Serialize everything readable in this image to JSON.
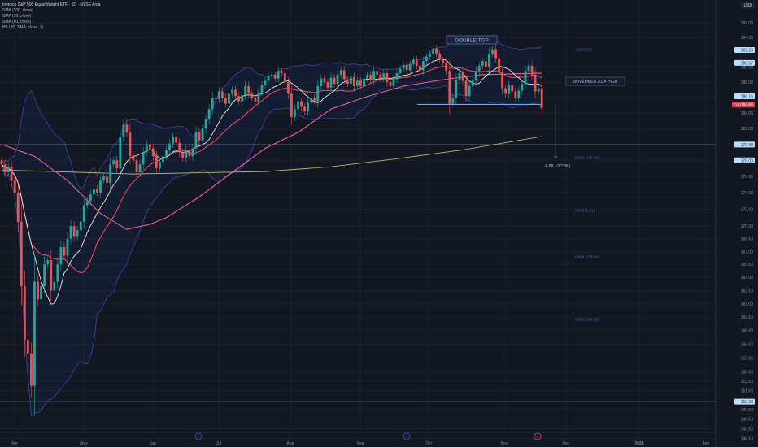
{
  "header": {
    "title": "Invesco S&P 500 Equal Weight ETF · 1D · NYSE Arca",
    "indicators": [
      "SMA (200, close)",
      "SMA (10, close)",
      "SMA (50, close)",
      "BB (20, SMA, close, 2)"
    ],
    "currency": "USD"
  },
  "colors": {
    "background": "#131722",
    "up": "#26a69a",
    "down": "#ef5350",
    "sma10": "#efe7cf",
    "bb_basis": "#f0465a",
    "sma50": "#ec5f99",
    "sma200": "#b8b46a",
    "bb_band": "#3949ab",
    "label_bg": "#bbdefb",
    "annotation": "#5b8fd6"
  },
  "chart_data": {
    "type": "candlestick",
    "symbol": "ESP",
    "scale": "log",
    "ylim": [
      145.5,
      197
    ],
    "grid": true,
    "x_ticks": [
      "Apr",
      "May",
      "Jun",
      "Jul",
      "Aug",
      "Sep",
      "Oct",
      "Nov",
      "Dec",
      "2026",
      "Feb"
    ],
    "y_ticks": [
      "196.00",
      "194.00",
      "190.00",
      "188.00",
      "186.00",
      "184.00",
      "182.00",
      "180.00",
      "178.00",
      "176.00",
      "174.00",
      "172.00",
      "170.00",
      "168.50",
      "167.00",
      "165.50",
      "164.00",
      "162.50",
      "161.00",
      "159.50",
      "158.00",
      "156.50",
      "155.00",
      "153.50",
      "152.50",
      "151.50",
      "149.50",
      "148.50",
      "147.50",
      "146.50"
    ],
    "closes": [
      177.5,
      176.5,
      177.2,
      175.5,
      174.0,
      170.5,
      163.0,
      157.0,
      155.5,
      152.0,
      163.5,
      161.5,
      163.0,
      165.5,
      166.0,
      162.5,
      163.5,
      165.5,
      167.5,
      166.5,
      168.5,
      170.0,
      168.8,
      169.5,
      170.5,
      172.5,
      173.0,
      173.8,
      174.5,
      174.0,
      175.5,
      176.0,
      175.2,
      177.5,
      178.0,
      177.0,
      181.0,
      182.5,
      181.5,
      178.5,
      178.0,
      176.5,
      177.5,
      179.0,
      180.0,
      179.5,
      178.5,
      177.0,
      177.8,
      178.5,
      179.3,
      180.1,
      181.0,
      180.2,
      179.0,
      178.3,
      179.3,
      178.5,
      179.5,
      181.5,
      180.5,
      182.0,
      183.2,
      184.5,
      186.0,
      185.8,
      186.8,
      186.0,
      185.2,
      186.5,
      187.0,
      186.2,
      185.5,
      186.3,
      187.5,
      186.5,
      186.0,
      185.5,
      186.7,
      187.6,
      188.2,
      188.8,
      189.0,
      188.5,
      189.5,
      189.2,
      188.0,
      186.5,
      183.5,
      184.5,
      185.5,
      184.8,
      184.2,
      185.3,
      186.0,
      185.5,
      187.5,
      188.5,
      188.0,
      187.3,
      188.6,
      187.8,
      189.0,
      189.6,
      188.4,
      187.8,
      188.7,
      187.5,
      188.2,
      187.5,
      188.5,
      189.0,
      188.3,
      189.5,
      189.0,
      188.5,
      189.2,
      188.0,
      187.5,
      188.4,
      189.2,
      189.8,
      190.3,
      189.6,
      190.4,
      191.0,
      190.2,
      189.6,
      190.8,
      191.4,
      191.8,
      192.5,
      191.8,
      191.0,
      190.6,
      189.5,
      185.2,
      186.0,
      188.3,
      189.2,
      188.2,
      186.2,
      187.5,
      188.2,
      189.5,
      190.2,
      190.8,
      190.0,
      191.8,
      192.4,
      191.2,
      189.3,
      187.2,
      186.5,
      187.6,
      186.8,
      186.0,
      186.9,
      187.8,
      189.5,
      190.2,
      189.0,
      186.8,
      187.2,
      184.66
    ],
    "sma50": [
      [
        0,
        180.0
      ],
      [
        10,
        178.5
      ],
      [
        20,
        175.5
      ],
      [
        30,
        171.5
      ],
      [
        38,
        169.6
      ],
      [
        45,
        170.2
      ],
      [
        50,
        171.0
      ],
      [
        60,
        173.5
      ],
      [
        70,
        176.5
      ],
      [
        80,
        179.5
      ],
      [
        90,
        181.5
      ],
      [
        100,
        184.5
      ],
      [
        110,
        186.0
      ],
      [
        122,
        187.5
      ],
      [
        135,
        188.4
      ],
      [
        146,
        189.0
      ],
      [
        164,
        189.2
      ]
    ],
    "sma200": [
      [
        0,
        176.8
      ],
      [
        40,
        176.3
      ],
      [
        80,
        176.6
      ],
      [
        100,
        177.2
      ],
      [
        120,
        178.2
      ],
      [
        140,
        179.3
      ],
      [
        164,
        181.0
      ]
    ],
    "price_labels": [
      {
        "text": "192.30",
        "value": 192.3,
        "line": true
      },
      {
        "text": "190.57",
        "value": 190.57,
        "line": true
      },
      {
        "text": "186.16",
        "value": 186.16,
        "line": false
      },
      {
        "text": "185.11",
        "value": 185.11,
        "line": false
      },
      {
        "text": "179.98",
        "value": 179.98,
        "line": true
      },
      {
        "text": "178.00",
        "value": 178.0,
        "line": false
      },
      {
        "text": "150.33",
        "value": 150.33,
        "line": true
      }
    ],
    "last_price": {
      "symbol": "ESP",
      "text": "184.66",
      "value": 184.66
    },
    "annotations": {
      "double_top": "DOUBLE TOP",
      "double_top_level": 192.3,
      "neckline_level": 185.11,
      "november_high": "NOVEMBER 2024 HIGH",
      "measure": "-6.89 (-3.72%)",
      "measure_from": 185.11,
      "measure_to": 178.22
    },
    "fib_levels": [
      {
        "text": "1 (192.30)",
        "value": 192.3
      },
      {
        "text": "0.382 (178.28)",
        "value": 178.28
      },
      {
        "text": "0.5 (171.81)",
        "value": 171.81
      },
      {
        "text": "0.618 (166.34)",
        "value": 166.34
      },
      {
        "text": "0.786 (159.21)",
        "value": 159.21
      }
    ],
    "events": [
      {
        "type": "dividend",
        "label": "D"
      },
      {
        "type": "dividend",
        "label": "D"
      },
      {
        "type": "earnings",
        "label": "E"
      }
    ]
  }
}
